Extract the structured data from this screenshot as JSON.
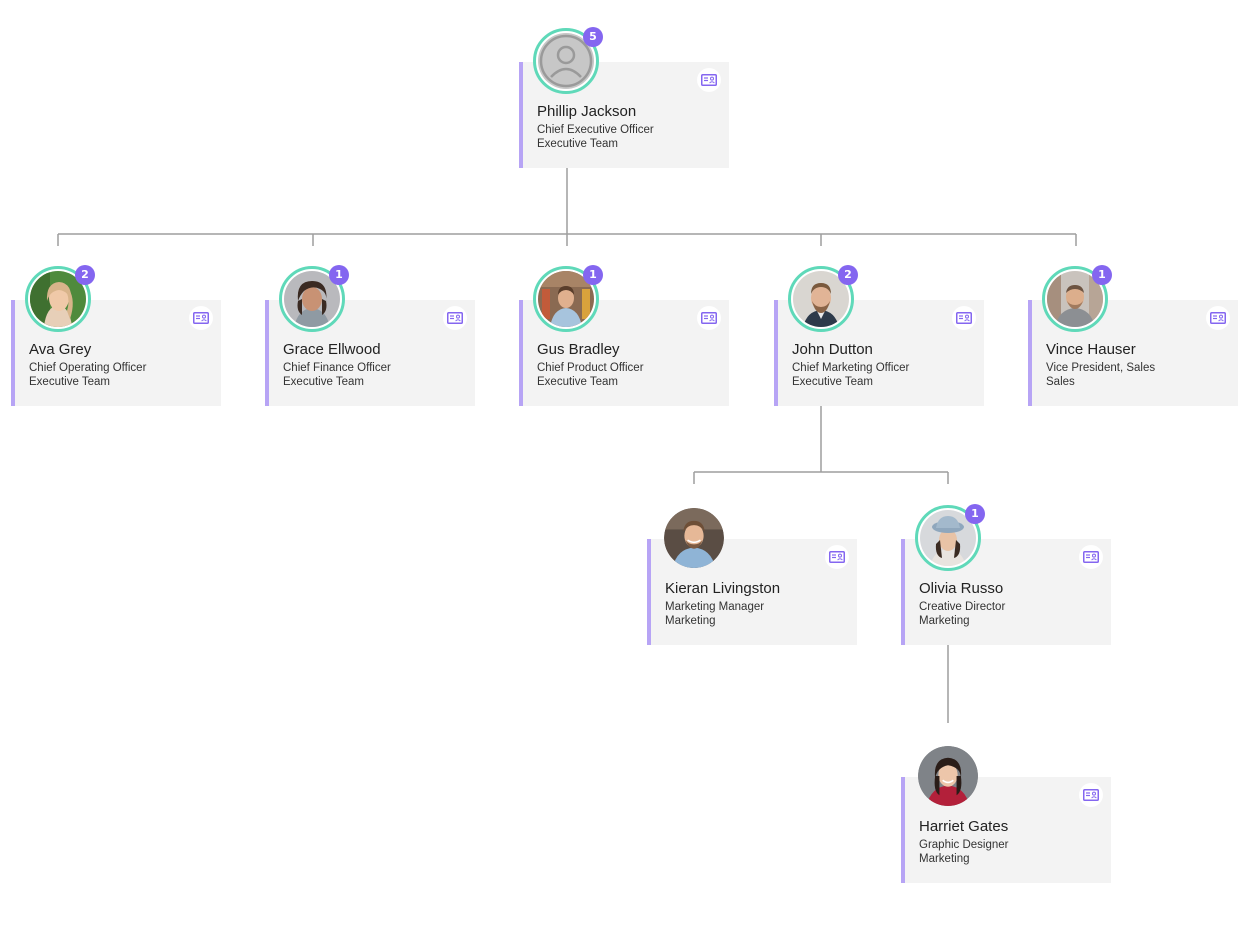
{
  "colors": {
    "accent": "#8466f0",
    "card_border": "#b7a4f5",
    "ring": "#5fd9b9",
    "card_bg": "#f3f3f3",
    "connector": "#9e9e9e"
  },
  "icons": {
    "card_button": "id-card-icon",
    "placeholder": "user-placeholder-icon"
  },
  "nodes": [
    {
      "id": "phillip-jackson",
      "name": "Phillip Jackson",
      "role": "Chief Executive Officer",
      "team": "Executive Team",
      "reports": "5",
      "photo": "placeholder"
    },
    {
      "id": "ava-grey",
      "name": "Ava Grey",
      "role": "Chief Operating Officer",
      "team": "Executive Team",
      "reports": "2",
      "photo": "woman-green-bg"
    },
    {
      "id": "grace-ellwood",
      "name": "Grace Ellwood",
      "role": "Chief Finance Officer",
      "team": "Executive Team",
      "reports": "1",
      "photo": "woman-curly"
    },
    {
      "id": "gus-bradley",
      "name": "Gus Bradley",
      "role": "Chief Product Officer",
      "team": "Executive Team",
      "reports": "1",
      "photo": "man-shop"
    },
    {
      "id": "john-dutton",
      "name": "John Dutton",
      "role": "Chief Marketing Officer",
      "team": "Executive Team",
      "reports": "2",
      "photo": "man-beard"
    },
    {
      "id": "vince-hauser",
      "name": "Vince Hauser",
      "role": "Vice President, Sales",
      "team": "Sales",
      "reports": "1",
      "photo": "man-outdoor"
    },
    {
      "id": "kieran-livingston",
      "name": "Kieran Livingston",
      "role": "Marketing Manager",
      "team": "Marketing",
      "reports": "",
      "photo": "man-smile"
    },
    {
      "id": "olivia-russo",
      "name": "Olivia Russo",
      "role": "Creative Director",
      "team": "Marketing",
      "reports": "1",
      "photo": "woman-hat"
    },
    {
      "id": "harriet-gates",
      "name": "Harriet Gates",
      "role": "Graphic Designer",
      "team": "Marketing",
      "reports": "",
      "photo": "woman-red"
    }
  ]
}
